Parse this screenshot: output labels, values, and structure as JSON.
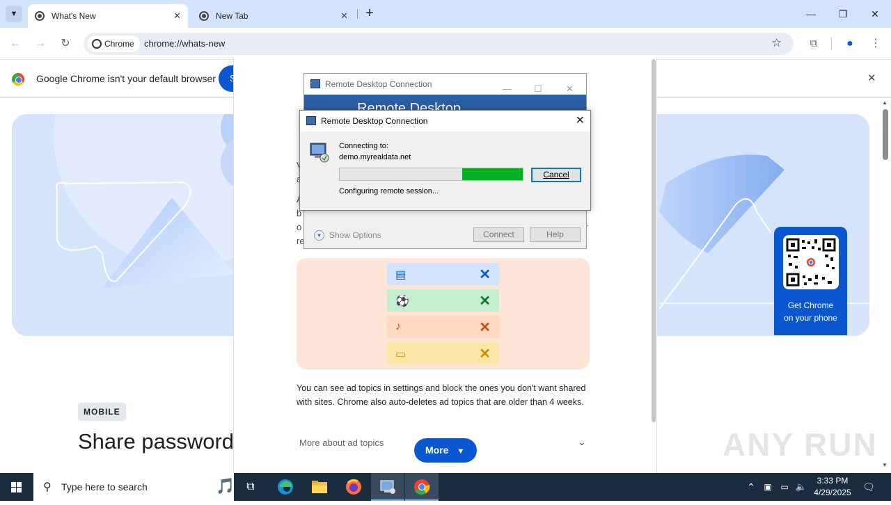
{
  "browser": {
    "tabs": [
      {
        "label": "What's New",
        "active": true
      },
      {
        "label": "New Tab",
        "active": false
      }
    ],
    "new_tab_symbol": "+",
    "window_controls": {
      "minimize": "—",
      "restore": "❐",
      "close": "✕"
    },
    "omnibox": {
      "chip_label": "Chrome",
      "url": "chrome://whats-new"
    }
  },
  "infobar": {
    "text": "Google Chrome isn't your default browser",
    "button_partial": "S",
    "close": "✕"
  },
  "page": {
    "qr_caption_line1": "Get Chrome",
    "qr_caption_line2": "on your phone",
    "mobile_badge": "MOBILE",
    "share_title": "Share password"
  },
  "modal": {
    "side_letters": [
      "V",
      "a",
      "A",
      "b",
      "o",
      "re"
    ],
    "right_letter": "r",
    "ad_paragraph": "You can see ad topics in settings and block the ones you don't want shared with sites. Chrome also auto-deletes ad topics that are older than 4 weeks.",
    "more_about": "More about ad topics",
    "more_button": "More",
    "topics": [
      {
        "icon": "calendar-icon",
        "glyph": "▤",
        "bg": "#d3e3fd",
        "fg": "#0b57d0",
        "x": "✕"
      },
      {
        "icon": "soccer-icon",
        "glyph": "⚽",
        "bg": "#c4eed0",
        "fg": "#137333",
        "x": "✕"
      },
      {
        "icon": "music-icon",
        "glyph": "♪",
        "bg": "#ffd9c2",
        "fg": "#c5500d",
        "x": "✕"
      },
      {
        "icon": "clapper-icon",
        "glyph": "▭",
        "bg": "#fde7a8",
        "fg": "#c79100",
        "x": "✕"
      }
    ]
  },
  "rdc_back": {
    "title": "Remote Desktop Connection",
    "banner": "Remote Desktop",
    "show_options": "Show Options",
    "connect": "Connect",
    "help": "Help"
  },
  "rdc_front": {
    "title": "Remote Desktop Connection",
    "connecting_label": "Connecting to:",
    "host": "demo.myrealdata.net",
    "status": "Configuring remote session...",
    "cancel": "Cancel",
    "progress_fill": {
      "start": 0.67,
      "end": 1.0
    }
  },
  "watermark": "ANY RUN",
  "taskbar": {
    "search_placeholder": "Type here to search",
    "time": "3:33 PM",
    "date": "4/29/2025",
    "apps": [
      "task-view-icon",
      "edge-icon",
      "file-explorer-icon",
      "firefox-icon",
      "remote-desktop-icon",
      "chrome-icon"
    ]
  },
  "colors": {
    "tabstrip": "#d3e3fd",
    "accent": "#0b57d0",
    "progress_green": "#06b025",
    "taskbar": "#1c2c3f"
  }
}
